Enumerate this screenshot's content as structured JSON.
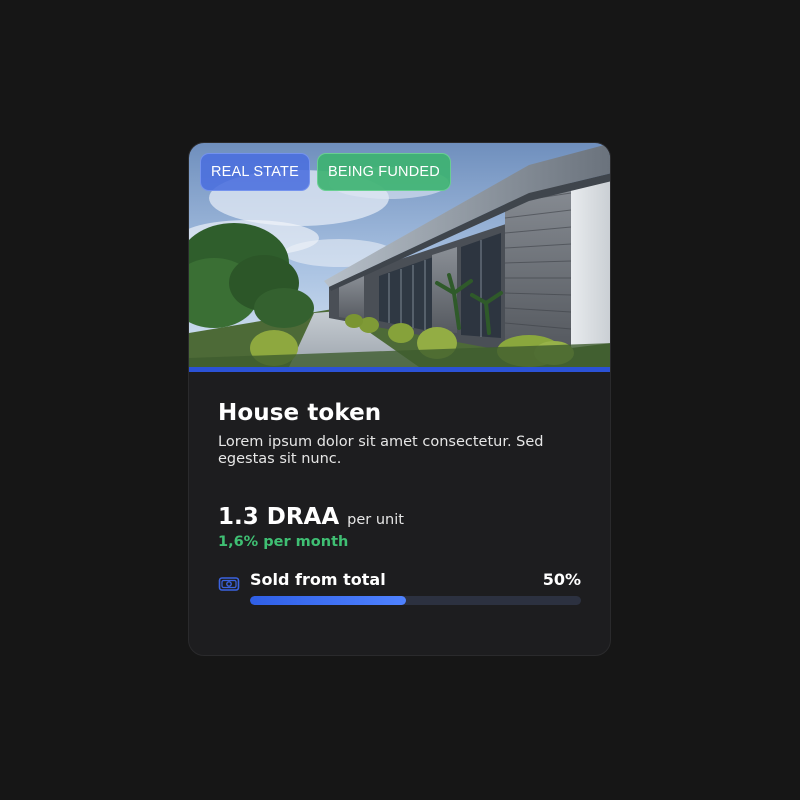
{
  "card": {
    "badges": {
      "category": "REAL STATE",
      "status": "BEING FUNDED"
    },
    "title": "House token",
    "description": "Lorem ipsum dolor sit amet consectetur. Sed egestas sit nunc.",
    "price": "1.3 DRAA",
    "price_unit": "per unit",
    "yield": "1,6% per month",
    "progress": {
      "label": "Sold from total",
      "value_text": "50%",
      "percent": 47
    }
  },
  "colors": {
    "accent": "#2b52d6",
    "success": "#3fbf73",
    "background": "#161616",
    "card": "#1d1d1f"
  },
  "icons": {
    "progress_icon": "money-icon"
  }
}
